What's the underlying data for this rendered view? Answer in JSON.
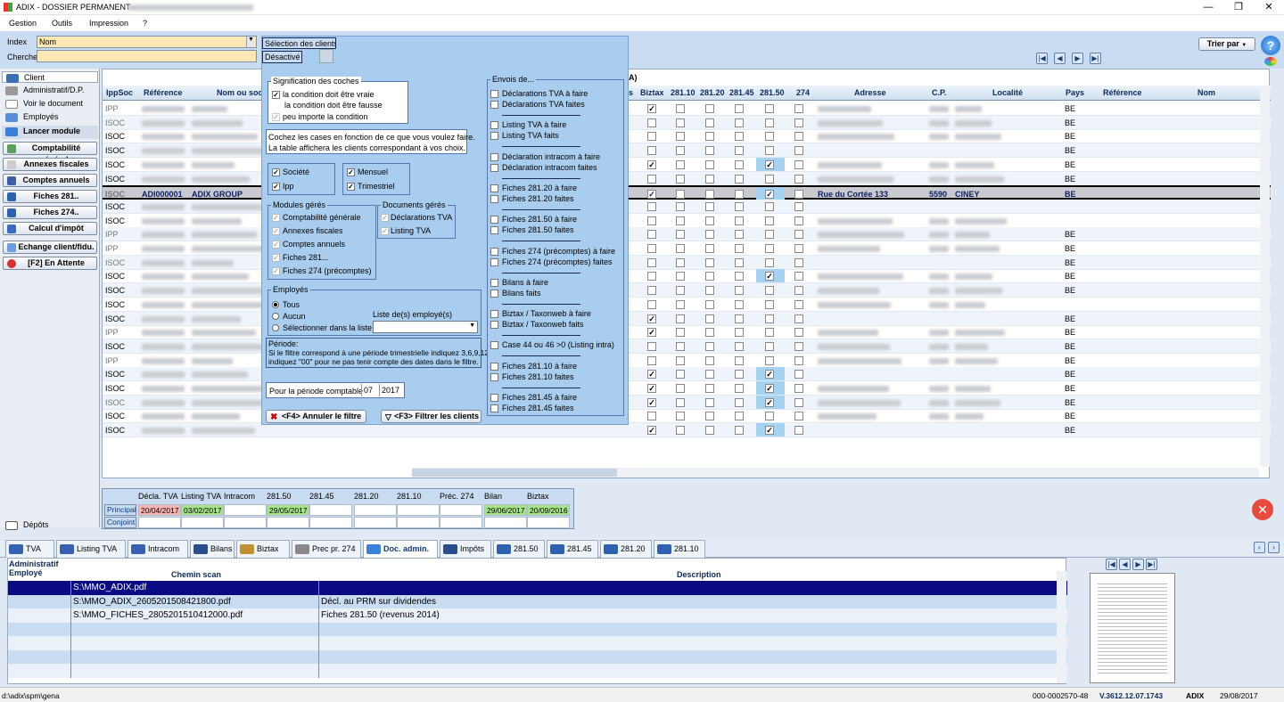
{
  "window": {
    "title": "ADIX - DOSSIER PERMANENT -"
  },
  "menu": [
    "Gestion",
    "Outils",
    "Impression",
    "?"
  ],
  "search": {
    "index_label": "Index",
    "index_value": "Nom",
    "cherche_label": "Cherche",
    "cherche_value": ""
  },
  "selection": {
    "label": "Sélection des clients...",
    "status": "Désactivé"
  },
  "sort_button": "Trier par",
  "sidebar": {
    "items": [
      "Client",
      "Administratif/D.P.",
      "Voir le document",
      "Employés"
    ],
    "lancer": "Lancer module",
    "buttons": [
      "Comptabilité générale",
      "Annexes fiscales",
      "Comptes annuels",
      "Fiches 281..",
      "Fiches 274..",
      "Calcul d'impôt",
      "Echange client/fidu.",
      "[F2] En Attente"
    ],
    "depots": "Dépôts"
  },
  "grid": {
    "group_header": "A)",
    "headers": {
      "ippsoc": "IppSoc",
      "reference": "Référence",
      "nom": "Nom ou soci",
      "s": "s",
      "biztax": "Biztax",
      "c28110": "281.10",
      "c28120": "281.20",
      "c28145": "281.45",
      "c28150": "281.50",
      "c274": "274",
      "adresse": "Adresse",
      "cp": "C.P.",
      "localite": "Localité",
      "pays": "Pays",
      "reference2": "Référence",
      "nom2": "Nom"
    },
    "rows": [
      {
        "type": "IPP",
        "pays": "BE",
        "biz": true,
        "c150": false
      },
      {
        "type": "ISOC",
        "pays": "BE",
        "biz": false,
        "c150": false
      },
      {
        "type": "ISOC",
        "pays": "BE",
        "biz": false,
        "c150": false
      },
      {
        "type": "ISOC",
        "pays": "BE",
        "biz": false,
        "c150": false
      },
      {
        "type": "ISOC",
        "pays": "BE",
        "biz": true,
        "c150": true
      },
      {
        "type": "ISOC",
        "pays": "BE",
        "biz": false,
        "c150": false
      },
      {
        "type": "ISOC",
        "ref": "ADI000001",
        "nom": "ADIX GROUP",
        "adresse": "Rue du Cortée 133",
        "cp": "5590",
        "localite": "CINEY",
        "pays": "BE",
        "biz": true,
        "c150": true,
        "selected": true
      },
      {
        "type": "ISOC",
        "pays": "",
        "biz": false,
        "c150": false
      },
      {
        "type": "ISOC",
        "pays": "",
        "biz": false,
        "c150": false
      },
      {
        "type": "IPP",
        "pays": "BE",
        "biz": false,
        "c150": false
      },
      {
        "type": "IPP",
        "pays": "BE",
        "biz": false,
        "c150": false
      },
      {
        "type": "ISOC",
        "pays": "BE",
        "biz": false,
        "c150": false
      },
      {
        "type": "ISOC",
        "pays": "BE",
        "biz": false,
        "c150": true
      },
      {
        "type": "ISOC",
        "pays": "BE",
        "biz": false,
        "c150": false
      },
      {
        "type": "ISOC",
        "pays": "",
        "biz": false,
        "c150": false
      },
      {
        "type": "ISOC",
        "pays": "BE",
        "biz": true,
        "c150": false
      },
      {
        "type": "IPP",
        "pays": "BE",
        "biz": true,
        "c150": false
      },
      {
        "type": "ISOC",
        "pays": "BE",
        "biz": false,
        "c150": false
      },
      {
        "type": "IPP",
        "pays": "BE",
        "biz": false,
        "c150": false
      },
      {
        "type": "ISOC",
        "pays": "BE",
        "biz": true,
        "c150": true
      },
      {
        "type": "ISOC",
        "pays": "BE",
        "biz": true,
        "c150": true
      },
      {
        "type": "ISOC",
        "pays": "BE",
        "biz": true,
        "c150": true
      },
      {
        "type": "ISOC",
        "pays": "BE",
        "biz": false,
        "c150": false
      },
      {
        "type": "ISOC",
        "pays": "BE",
        "biz": true,
        "c150": true
      }
    ]
  },
  "popup": {
    "signification_title": "Signification des coches",
    "signification": [
      "la condition doit être vraie",
      "la condition doit être fausse",
      "peu importe la condition"
    ],
    "info_text": [
      "Cochez les cases en fonction de ce que vous voulez faire.",
      "La table affichera les clients correspondant à vos choix."
    ],
    "types": [
      "Société",
      "Ipp"
    ],
    "periodes": [
      "Mensuel",
      "Trimestriel"
    ],
    "modules_title": "Modules gérés",
    "modules": [
      "Comptabilité générale",
      "Annexes fiscales",
      "Comptes annuels",
      "Fiches 281...",
      "Fiches 274 (précomptes)"
    ],
    "documents_title": "Documents gérés",
    "documents": [
      "Déclarations TVA",
      "Listing TVA"
    ],
    "employes_title": "Employés",
    "employes_options": [
      "Tous",
      "Aucun",
      "Sélectionner dans la liste"
    ],
    "liste_label": "Liste de(s) employé(s)",
    "periode_title": "Période:",
    "periode_text": [
      "Si le filtre correspond à une période trimestrielle indiquez 3,6,9,12",
      "indiquez \"00\" pour ne pas tenir compte des dates dans le filtre."
    ],
    "periode_label": "Pour la période comptable",
    "periode_month": "07",
    "periode_year": "2017",
    "cancel_btn": "<F4> Annuler le filtre",
    "filter_btn": "<F3> Filtrer les clients",
    "envois_title": "Envois de...",
    "envois": [
      [
        "Déclarations TVA à faire",
        "Déclarations TVA faites"
      ],
      [
        "Listing TVA à faire",
        "Listing TVA faits"
      ],
      [
        "Déclaration intracom à faire",
        "Déclaration intracom faites"
      ],
      [
        "Fiches 281.20 à faire",
        "Fiches 281.20 faites"
      ],
      [
        "Fiches 281.50 à faire",
        "Fiches 281.50 faites"
      ],
      [
        "Fiches 274 (précomptes) à faire",
        "Fiches 274 (précomptes) faites"
      ],
      [
        "Bilans à faire",
        "Bilans faits"
      ],
      [
        "Biztax / Taxonweb à faire",
        "Biztax / Taxonweb faits"
      ],
      [
        "Case 44 ou 46 >0 (Listing intra)"
      ],
      [
        "Fiches 281.10 à faire",
        "Fiches 281.10 faites"
      ],
      [
        "Fiches 281.45 à faire",
        "Fiches 281.45 faites"
      ]
    ]
  },
  "dates": {
    "headers": [
      "Décla. TVA",
      "Listing TVA",
      "Intracom",
      "281.50",
      "281.45",
      "281.20",
      "281.10",
      "Préc. 274",
      "Bilan",
      "Biztax"
    ],
    "principal_label": "Principal",
    "conjoint_label": "Conjoint",
    "principal": [
      "20/04/2017",
      "03/02/2017",
      "",
      "29/05/2017",
      "",
      "",
      "",
      "",
      "29/06/2017",
      "20/09/2016"
    ]
  },
  "tabs": [
    "TVA",
    "Listing TVA",
    "Intracom",
    "Bilans",
    "Biztax",
    "Prec pr. 274",
    "Doc. admin.",
    "Impôts",
    "281.50",
    "281.45",
    "281.20",
    "281.10"
  ],
  "bottom": {
    "headers": {
      "employe": "Administratif Employé",
      "chemin": "Chemin scan",
      "description": "Description"
    },
    "rows": [
      {
        "chemin": "S:\\MMO_ADIX.pdf",
        "desc": ""
      },
      {
        "chemin": "S:\\MMO_ADIX_2605201508421800.pdf",
        "desc": "Décl. au PRM sur dividendes"
      },
      {
        "chemin": "S:\\MMO_FICHES_2805201510412000.pdf",
        "desc": "Fiches 281.50 (revenus 2014)"
      }
    ]
  },
  "status": {
    "path": "d:\\adix\\spm\\gena",
    "code": "000-0002570-48",
    "version": "V.3612.12.07.1743",
    "app": "ADIX",
    "date": "29/08/2017"
  },
  "colors": {
    "selected_bg": "#0a0a82",
    "accent": "#0b3a84",
    "red": "#e84b3c",
    "green": "#a6e38a",
    "pink": "#f7b5b3"
  }
}
